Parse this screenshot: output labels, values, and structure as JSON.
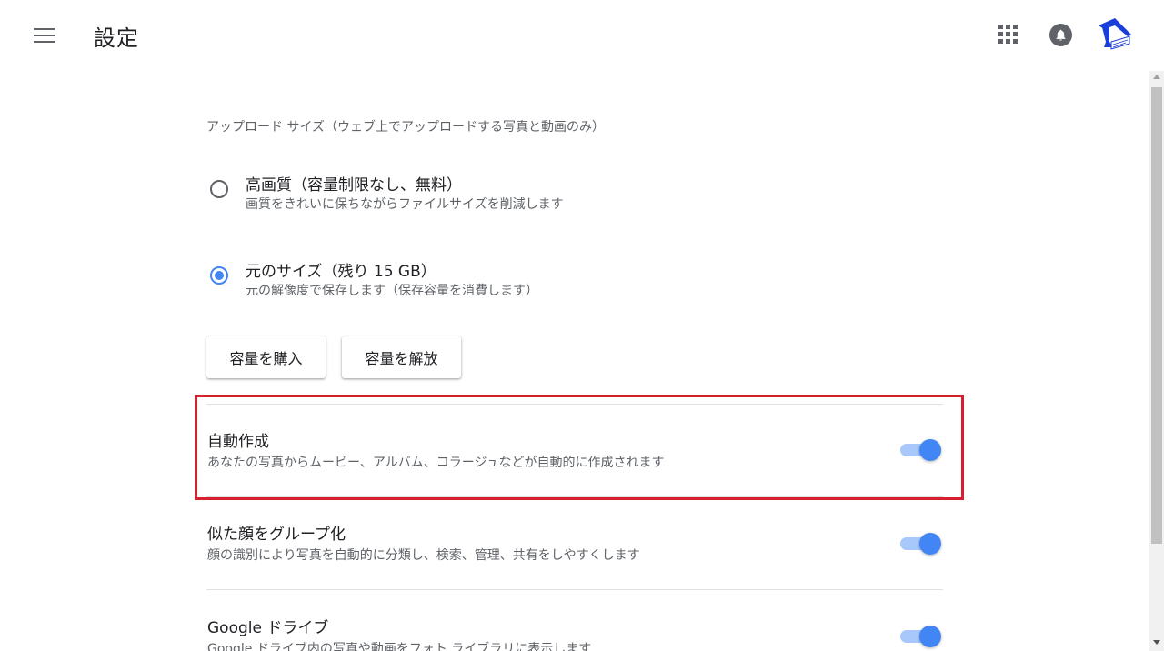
{
  "header": {
    "title": "設定",
    "menu_icon": "hamburger-menu-icon",
    "apps_icon": "apps-grid-icon",
    "notification_icon": "bell-icon"
  },
  "upload": {
    "section_label": "アップロード サイズ（ウェブ上でアップロードする写真と動画のみ）",
    "options": [
      {
        "title": "高画質（容量制限なし、無料）",
        "desc": "画質をきれいに保ちながらファイルサイズを削減します",
        "selected": false
      },
      {
        "title": "元のサイズ（残り 15 GB）",
        "desc": "元の解像度で保存します（保存容量を消費します）",
        "selected": true
      }
    ],
    "buttons": {
      "buy": "容量を購入",
      "free_up": "容量を解放"
    }
  },
  "settings": [
    {
      "title": "自動作成",
      "desc": "あなたの写真からムービー、アルバム、コラージュなどが自動的に作成されます",
      "enabled": true
    },
    {
      "title": "似た顔をグループ化",
      "desc": "顔の識別により写真を自動的に分類し、検索、管理、共有をしやすくします",
      "enabled": true
    },
    {
      "title": "Google ドライブ",
      "desc": "Google ドライブ内の写真や動画をフォト ライブラリに表示します",
      "enabled": true
    }
  ],
  "colors": {
    "accent": "#4285f4",
    "highlight": "#d7202f"
  }
}
